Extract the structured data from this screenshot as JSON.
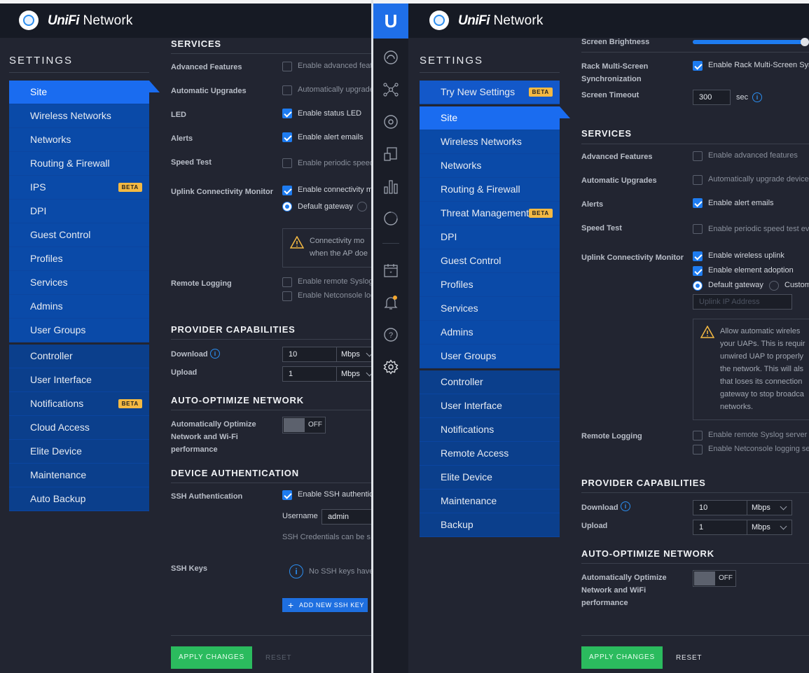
{
  "brand": {
    "name_a": "UniFi",
    "name_b": "Network"
  },
  "left": {
    "settings_title": "SETTINGS",
    "nav_primary": [
      {
        "label": "Site",
        "active": true
      },
      {
        "label": "Wireless Networks"
      },
      {
        "label": "Networks"
      },
      {
        "label": "Routing & Firewall"
      },
      {
        "label": "IPS",
        "badge": "BETA"
      },
      {
        "label": "DPI"
      },
      {
        "label": "Guest Control"
      },
      {
        "label": "Profiles"
      },
      {
        "label": "Services"
      },
      {
        "label": "Admins"
      },
      {
        "label": "User Groups"
      }
    ],
    "nav_secondary": [
      {
        "label": "Controller"
      },
      {
        "label": "User Interface"
      },
      {
        "label": "Notifications",
        "badge": "BETA"
      },
      {
        "label": "Cloud Access"
      },
      {
        "label": "Elite Device"
      },
      {
        "label": "Maintenance"
      },
      {
        "label": "Auto Backup"
      }
    ],
    "services": {
      "title": "SERVICES",
      "advanced_features": {
        "label": "Advanced Features",
        "text": "Enable advanced feature",
        "checked": false
      },
      "auto_upgrades": {
        "label": "Automatic Upgrades",
        "text": "Automatically upgrade",
        "checked": false
      },
      "led": {
        "label": "LED",
        "text": "Enable status LED",
        "checked": true
      },
      "alerts": {
        "label": "Alerts",
        "text": "Enable alert emails",
        "checked": true
      },
      "speed_test": {
        "label": "Speed Test",
        "text": "Enable periodic speed",
        "checked": false
      },
      "uplink": {
        "label": "Uplink Connectivity Monitor",
        "text": "Enable connectivity m",
        "checked": true,
        "radio_default": "Default gateway"
      },
      "warning": "Connectivity mo\nwhen the AP doe",
      "remote_logging": {
        "label": "Remote Logging",
        "syslog": "Enable remote Syslog",
        "netconsole": "Enable Netconsole log"
      }
    },
    "provider": {
      "title": "PROVIDER CAPABILITIES",
      "download_label": "Download",
      "download_value": "10",
      "download_unit": "Mbps",
      "upload_label": "Upload",
      "upload_value": "1",
      "upload_unit": "Mbps"
    },
    "auto_opt": {
      "title": "AUTO-OPTIMIZE NETWORK",
      "label": "Automatically Optimize Network and Wi-Fi performance",
      "state": "OFF"
    },
    "device_auth": {
      "title": "DEVICE AUTHENTICATION",
      "ssh_label": "SSH Authentication",
      "ssh_text": "Enable SSH authentic",
      "username_label": "Username",
      "username_value": "admin",
      "credentials_note": "SSH Credentials can be s",
      "keys_label": "SSH Keys",
      "keys_empty": "No SSH keys have",
      "add_key": "ADD NEW SSH KEY"
    },
    "apply": "APPLY CHANGES",
    "reset": "RESET"
  },
  "right": {
    "settings_title": "SETTINGS",
    "nav_try": {
      "label": "Try New Settings",
      "badge": "BETA"
    },
    "nav_primary": [
      {
        "label": "Site",
        "active": true
      },
      {
        "label": "Wireless Networks"
      },
      {
        "label": "Networks"
      },
      {
        "label": "Routing & Firewall"
      },
      {
        "label": "Threat Management",
        "badge": "BETA"
      },
      {
        "label": "DPI"
      },
      {
        "label": "Guest Control"
      },
      {
        "label": "Profiles"
      },
      {
        "label": "Services"
      },
      {
        "label": "Admins"
      },
      {
        "label": "User Groups"
      }
    ],
    "nav_secondary": [
      {
        "label": "Controller"
      },
      {
        "label": "User Interface"
      },
      {
        "label": "Notifications"
      },
      {
        "label": "Remote Access"
      },
      {
        "label": "Elite Device"
      },
      {
        "label": "Maintenance"
      },
      {
        "label": "Backup"
      }
    ],
    "top": {
      "brightness_label": "Screen Brightness",
      "brightness_value": 1.0,
      "rack_label": "Rack Multi-Screen Synchronization",
      "rack_text": "Enable Rack Multi-Screen Sync",
      "timeout_label": "Screen Timeout",
      "timeout_value": "300",
      "timeout_unit": "sec"
    },
    "services": {
      "title": "SERVICES",
      "advanced_features": {
        "label": "Advanced Features",
        "text": "Enable advanced features",
        "checked": false
      },
      "auto_upgrades": {
        "label": "Automatic Upgrades",
        "text": "Automatically upgrade device",
        "checked": false
      },
      "alerts": {
        "label": "Alerts",
        "text": "Enable alert emails",
        "checked": true
      },
      "speed_test": {
        "label": "Speed Test",
        "text": "Enable periodic speed test eve",
        "checked": false
      },
      "uplink": {
        "label": "Uplink Connectivity Monitor",
        "wireless": "Enable wireless uplink",
        "adoption": "Enable element adoption",
        "radio_default": "Default gateway",
        "radio_custom": "Custom",
        "ip_placeholder": "Uplink IP Address"
      },
      "warning": "Allow automatic wireles\nyour UAPs. This is requir\nunwired UAP to properly\nthe network. This will als\nthat loses its connection\ngateway to stop broadca\nnetworks.",
      "remote_logging": {
        "label": "Remote Logging",
        "syslog": "Enable remote Syslog server",
        "netconsole": "Enable Netconsole logging ser"
      }
    },
    "provider": {
      "title": "PROVIDER CAPABILITIES",
      "download_label": "Download",
      "download_value": "10",
      "download_unit": "Mbps",
      "upload_label": "Upload",
      "upload_value": "1",
      "upload_unit": "Mbps"
    },
    "auto_opt": {
      "title": "AUTO-OPTIMIZE NETWORK",
      "label": "Automatically Optimize Network and WiFi performance",
      "state": "OFF"
    },
    "apply": "APPLY CHANGES",
    "reset": "RESET"
  },
  "icons": [
    "unifi-logo-icon",
    "dashboard-icon",
    "topology-icon",
    "devices-icon",
    "clients-icon",
    "statistics-icon",
    "insights-icon",
    "events-icon",
    "alerts-icon",
    "help-icon",
    "settings-icon",
    "warning-icon",
    "info-icon"
  ],
  "colors": {
    "accent": "#1e7cf0",
    "nav": "#0a4aa8",
    "nav_active": "#1a6cf0",
    "apply": "#2bbb5e",
    "badge": "#f4b942",
    "warning": "#f4b942"
  }
}
